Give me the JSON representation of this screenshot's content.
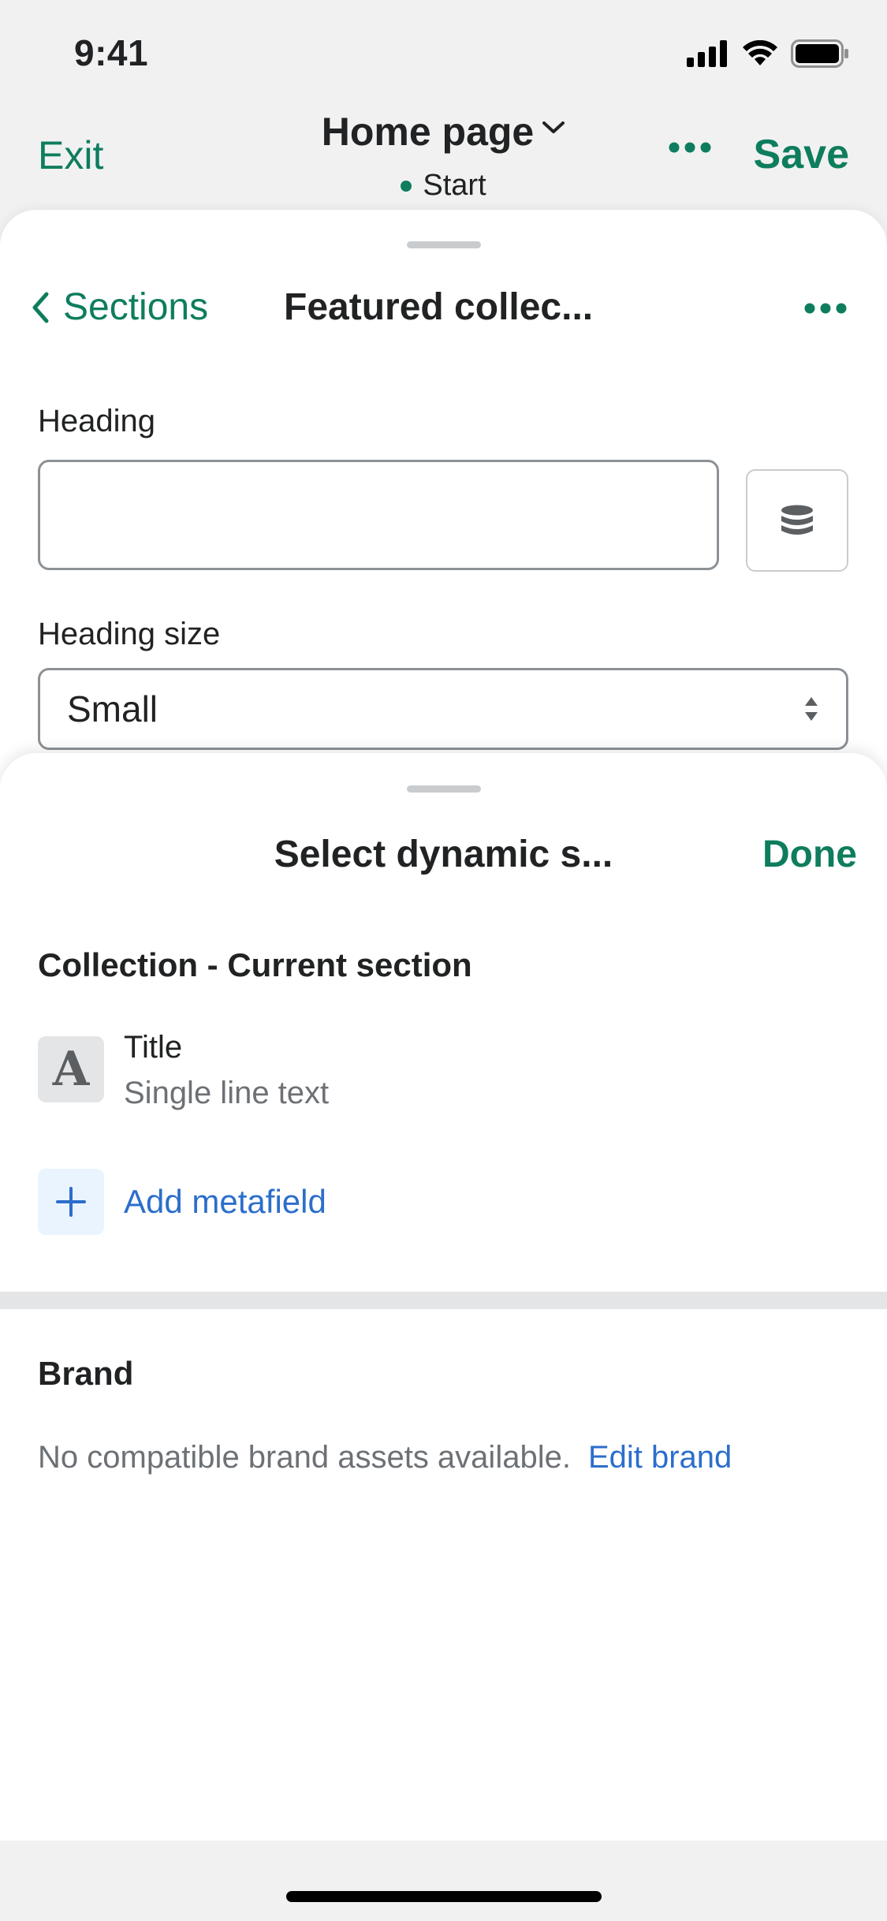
{
  "status_bar": {
    "time": "9:41"
  },
  "top_nav": {
    "exit_label": "Exit",
    "page_title": "Home page",
    "page_status": "Start",
    "save_label": "Save"
  },
  "section_panel": {
    "back_label": "Sections",
    "title": "Featured collec...",
    "heading_label": "Heading",
    "heading_value": "",
    "heading_size_label": "Heading size",
    "heading_size_value": "Small"
  },
  "dynamic_sheet": {
    "title": "Select dynamic s...",
    "done_label": "Done",
    "collection_group": {
      "title": "Collection - Current section",
      "field": {
        "icon_letter": "A",
        "name": "Title",
        "type": "Single line text"
      },
      "add_label": "Add metafield"
    },
    "brand_group": {
      "title": "Brand",
      "empty_text": "No compatible brand assets available.",
      "edit_label": "Edit brand"
    }
  },
  "colors": {
    "accent_green": "#0e7d5d",
    "link_blue": "#2c6ecb",
    "text_primary": "#202223",
    "text_subdued": "#6d7175"
  },
  "icons": {
    "back": "chevron-left-icon",
    "title_dropdown": "chevron-down-icon",
    "more": "more-horizontal-icon",
    "dynamic_source": "database-icon",
    "select": "select-arrows-icon",
    "field_type": "text-type-icon",
    "add": "plus-icon"
  }
}
